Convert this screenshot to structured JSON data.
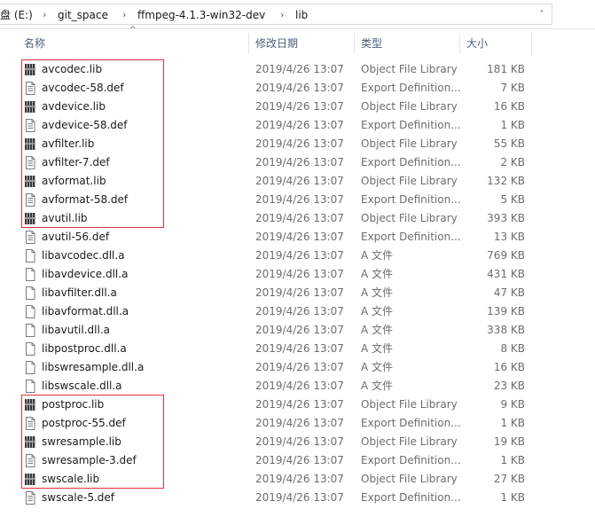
{
  "address": {
    "crumbs": [
      "盘 (E:)",
      "git_space",
      "ffmpeg-4.1.3-win32-dev",
      "lib"
    ],
    "separator": "›",
    "dropdown": "˅"
  },
  "columns": {
    "name": "名称",
    "date": "修改日期",
    "type": "类型",
    "size": "大小"
  },
  "sort_indicator": "^",
  "files": [
    {
      "name": "avcodec.lib",
      "date": "2019/4/26 13:07",
      "type": "Object File Library",
      "size": "181 KB",
      "icon": "lib-file-icon"
    },
    {
      "name": "avcodec-58.def",
      "date": "2019/4/26 13:07",
      "type": "Export Definition...",
      "size": "7 KB",
      "icon": "def-file-icon"
    },
    {
      "name": "avdevice.lib",
      "date": "2019/4/26 13:07",
      "type": "Object File Library",
      "size": "16 KB",
      "icon": "lib-file-icon"
    },
    {
      "name": "avdevice-58.def",
      "date": "2019/4/26 13:07",
      "type": "Export Definition...",
      "size": "1 KB",
      "icon": "def-file-icon"
    },
    {
      "name": "avfilter.lib",
      "date": "2019/4/26 13:07",
      "type": "Object File Library",
      "size": "55 KB",
      "icon": "lib-file-icon"
    },
    {
      "name": "avfilter-7.def",
      "date": "2019/4/26 13:07",
      "type": "Export Definition...",
      "size": "2 KB",
      "icon": "def-file-icon"
    },
    {
      "name": "avformat.lib",
      "date": "2019/4/26 13:07",
      "type": "Object File Library",
      "size": "132 KB",
      "icon": "lib-file-icon"
    },
    {
      "name": "avformat-58.def",
      "date": "2019/4/26 13:07",
      "type": "Export Definition...",
      "size": "5 KB",
      "icon": "def-file-icon"
    },
    {
      "name": "avutil.lib",
      "date": "2019/4/26 13:07",
      "type": "Object File Library",
      "size": "393 KB",
      "icon": "lib-file-icon"
    },
    {
      "name": "avutil-56.def",
      "date": "2019/4/26 13:07",
      "type": "Export Definition...",
      "size": "13 KB",
      "icon": "def-file-icon"
    },
    {
      "name": "libavcodec.dll.a",
      "date": "2019/4/26 13:07",
      "type": "A 文件",
      "size": "769 KB",
      "icon": "blank-file-icon"
    },
    {
      "name": "libavdevice.dll.a",
      "date": "2019/4/26 13:07",
      "type": "A 文件",
      "size": "431 KB",
      "icon": "blank-file-icon"
    },
    {
      "name": "libavfilter.dll.a",
      "date": "2019/4/26 13:07",
      "type": "A 文件",
      "size": "47 KB",
      "icon": "blank-file-icon"
    },
    {
      "name": "libavformat.dll.a",
      "date": "2019/4/26 13:07",
      "type": "A 文件",
      "size": "139 KB",
      "icon": "blank-file-icon"
    },
    {
      "name": "libavutil.dll.a",
      "date": "2019/4/26 13:07",
      "type": "A 文件",
      "size": "338 KB",
      "icon": "blank-file-icon"
    },
    {
      "name": "libpostproc.dll.a",
      "date": "2019/4/26 13:07",
      "type": "A 文件",
      "size": "8 KB",
      "icon": "blank-file-icon"
    },
    {
      "name": "libswresample.dll.a",
      "date": "2019/4/26 13:07",
      "type": "A 文件",
      "size": "16 KB",
      "icon": "blank-file-icon"
    },
    {
      "name": "libswscale.dll.a",
      "date": "2019/4/26 13:07",
      "type": "A 文件",
      "size": "23 KB",
      "icon": "blank-file-icon"
    },
    {
      "name": "postproc.lib",
      "date": "2019/4/26 13:07",
      "type": "Object File Library",
      "size": "9 KB",
      "icon": "lib-file-icon"
    },
    {
      "name": "postproc-55.def",
      "date": "2019/4/26 13:07",
      "type": "Export Definition...",
      "size": "1 KB",
      "icon": "def-file-icon"
    },
    {
      "name": "swresample.lib",
      "date": "2019/4/26 13:07",
      "type": "Object File Library",
      "size": "19 KB",
      "icon": "lib-file-icon"
    },
    {
      "name": "swresample-3.def",
      "date": "2019/4/26 13:07",
      "type": "Export Definition...",
      "size": "1 KB",
      "icon": "def-file-icon"
    },
    {
      "name": "swscale.lib",
      "date": "2019/4/26 13:07",
      "type": "Object File Library",
      "size": "27 KB",
      "icon": "lib-file-icon"
    },
    {
      "name": "swscale-5.def",
      "date": "2019/4/26 13:07",
      "type": "Export Definition...",
      "size": "1 KB",
      "icon": "def-file-icon"
    }
  ],
  "highlight_color": "#e2323b",
  "highlight_groups": [
    {
      "first_row": 0,
      "last_row": 8
    },
    {
      "first_row": 18,
      "last_row": 22
    }
  ]
}
